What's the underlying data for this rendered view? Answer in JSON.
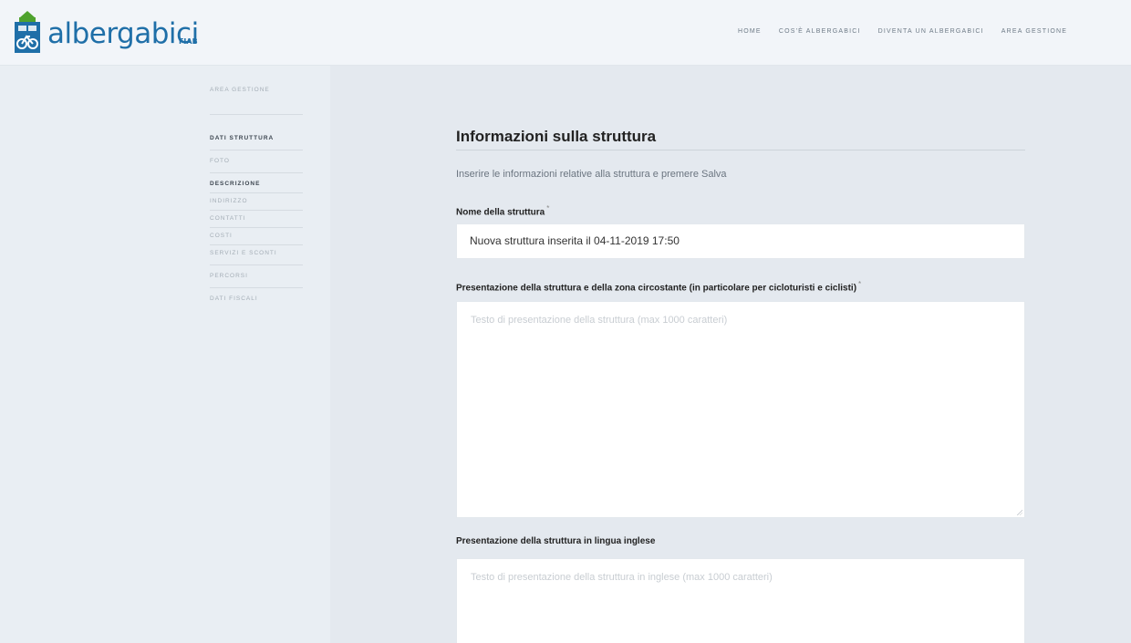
{
  "brand": {
    "name": "albergabici",
    "sub": "FIAB",
    "colors": {
      "primary": "#1f6fa8",
      "accent": "#4fa22e"
    }
  },
  "nav": {
    "items": [
      "HOME",
      "COS'È ALBERGABICI",
      "DIVENTA UN ALBERGABICI",
      "AREA GESTIONE"
    ]
  },
  "sidebar": {
    "items": [
      {
        "label": "AREA GESTIONE"
      },
      {
        "label": "DATI STRUTTURA"
      },
      {
        "label": "FOTO"
      },
      {
        "label": "DESCRIZIONE"
      },
      {
        "label": "INDIRIZZO"
      },
      {
        "label": "CONTATTI"
      },
      {
        "label": "COSTI"
      },
      {
        "label": "SERVIZI E SCONTI"
      },
      {
        "label": "PERCORSI"
      },
      {
        "label": "DATI FISCALI"
      }
    ]
  },
  "form": {
    "title": "Informazioni sulla struttura",
    "intro": "Inserire le informazioni relative alla struttura e premere Salva",
    "required_mark": "*",
    "name_label": "Nome della struttura",
    "name_value": "Nuova struttura inserita il 04-11-2019 17:50",
    "presentation_label": "Presentazione della struttura e della zona circostante (in particolare per cicloturisti e ciclisti)",
    "presentation_placeholder": "Testo di presentazione della struttura (max 1000 caratteri)",
    "presentation_en_label": "Presentazione della struttura in lingua inglese",
    "presentation_en_placeholder": "Testo di presentazione della struttura in inglese (max 1000 caratteri)"
  }
}
